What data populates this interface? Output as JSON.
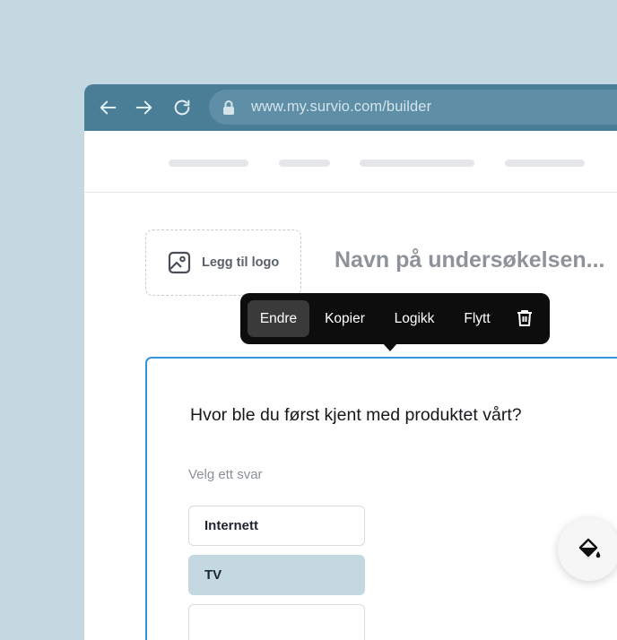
{
  "browser": {
    "url": "www.my.survio.com/builder",
    "icons": [
      "back-arrow-icon",
      "forward-arrow-icon",
      "reload-icon",
      "lock-icon"
    ]
  },
  "builder": {
    "logo_label": "Legg til logo",
    "survey_title": "Navn på undersøkelsen...",
    "toolbar": {
      "items": [
        {
          "label": "Endre",
          "active": true
        },
        {
          "label": "Kopier",
          "active": false
        },
        {
          "label": "Logikk",
          "active": false
        },
        {
          "label": "Flytt",
          "active": false
        }
      ],
      "delete_icon": "trash-icon"
    },
    "question": {
      "text": "Hvor ble du først kjent med produktet vårt?",
      "hint": "Velg ett svar",
      "options": [
        {
          "label": "Internett",
          "selected": false
        },
        {
          "label": "TV",
          "selected": true
        },
        {
          "label": "",
          "selected": false
        }
      ]
    },
    "fab_icon": "paint-bucket-icon"
  },
  "colors": {
    "background": "#c3d8e0",
    "chrome": "#4a7d96",
    "accent": "#3395da",
    "selected_option": "#c3d8e0"
  }
}
